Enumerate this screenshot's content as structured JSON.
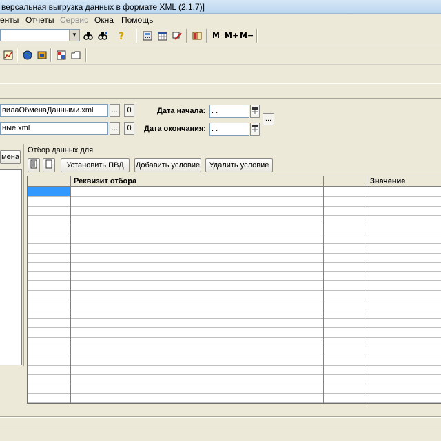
{
  "window": {
    "title": "версальная выгрузка данных в формате XML (2.1.7)]"
  },
  "menu": {
    "items": [
      {
        "label": "енты",
        "enabled": true
      },
      {
        "label": "Отчеты",
        "enabled": true
      },
      {
        "label": "Сервис",
        "enabled": false
      },
      {
        "label": "Окна",
        "enabled": true
      },
      {
        "label": "Помощь",
        "enabled": true
      }
    ]
  },
  "toolbar": {
    "combo_value": "",
    "m_label": "M",
    "m_plus_label": "M+",
    "m_minus_label": "M−",
    "icons": [
      "find-icon",
      "find-next-icon",
      "help-icon",
      "calculator-icon",
      "calendar-icon",
      "pencil-icon",
      "book-icon",
      "chart-icon",
      "globe-icon",
      "archive-icon",
      "image-icon",
      "folder-icon"
    ]
  },
  "form": {
    "rules_file": "вилаОбменаДанными.xml",
    "data_file": "ные.xml",
    "file_btn_label": "...",
    "open_btn_label": "0",
    "date_start_label": "Дата начала:",
    "date_end_label": "Дата окончания:",
    "date_start_value": " .  .",
    "date_end_value": " .  .",
    "period_btn_label": "..."
  },
  "left": {
    "button_label": "мена"
  },
  "filter": {
    "caption": "Отбор данных для",
    "set_pvd_label": "Установить ПВД",
    "add_condition_label": "Добавить условие",
    "delete_condition_label": "Удалить условие"
  },
  "grid": {
    "columns": [
      "",
      "Реквизит отбора",
      "",
      "Значение"
    ],
    "row_count": 23
  },
  "colors": {
    "selection": "#3399ff",
    "window_bg": "#ece9d8",
    "field_border": "#7f9db9"
  }
}
